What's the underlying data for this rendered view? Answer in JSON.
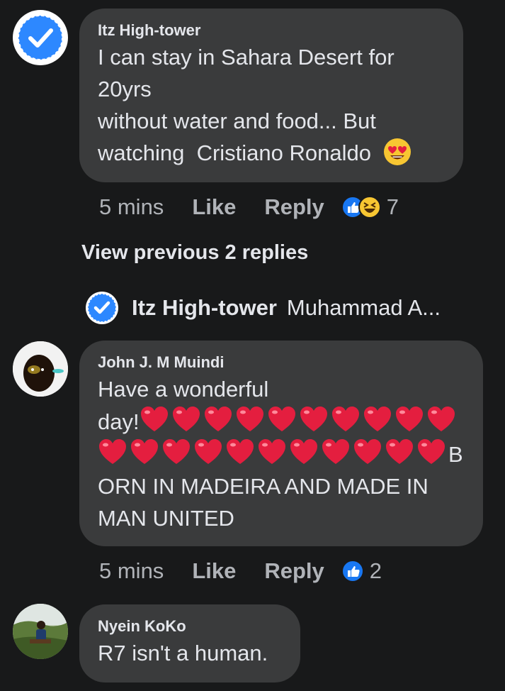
{
  "comments": [
    {
      "author": "Itz High-tower",
      "lines": [
        "I can stay in Sahara Desert for",
        "20yrs",
        "without water and food... But",
        "watching  Cristiano Ronaldo"
      ],
      "emoji": "heart-eyes-emoji",
      "time": "5 mins",
      "like_label": "Like",
      "reply_label": "Reply",
      "reactions": [
        "like",
        "haha"
      ],
      "reaction_count": "7"
    },
    {
      "author": "John J. M Muindi",
      "line1": "Have a wonderful",
      "line2_prefix": "day!",
      "line3_suffix": "B",
      "line4": "ORN IN MADEIRA AND MADE IN",
      "line5": "MAN UNITED",
      "time": "5 mins",
      "like_label": "Like",
      "reply_label": "Reply",
      "reactions": [
        "like"
      ],
      "reaction_count": "2"
    },
    {
      "author": "Nyein KoKo",
      "text": "R7 isn't a human."
    }
  ],
  "view_previous": "View previous 2 replies",
  "reply_preview": {
    "author": "Itz High-tower",
    "text": "Muhammad A..."
  },
  "colors": {
    "background": "#18191a",
    "bubble": "#3a3b3c",
    "text": "#e4e6eb",
    "meta": "#b0b3b8",
    "like_blue": "#1877f2",
    "heart_red": "#e41e3f"
  }
}
